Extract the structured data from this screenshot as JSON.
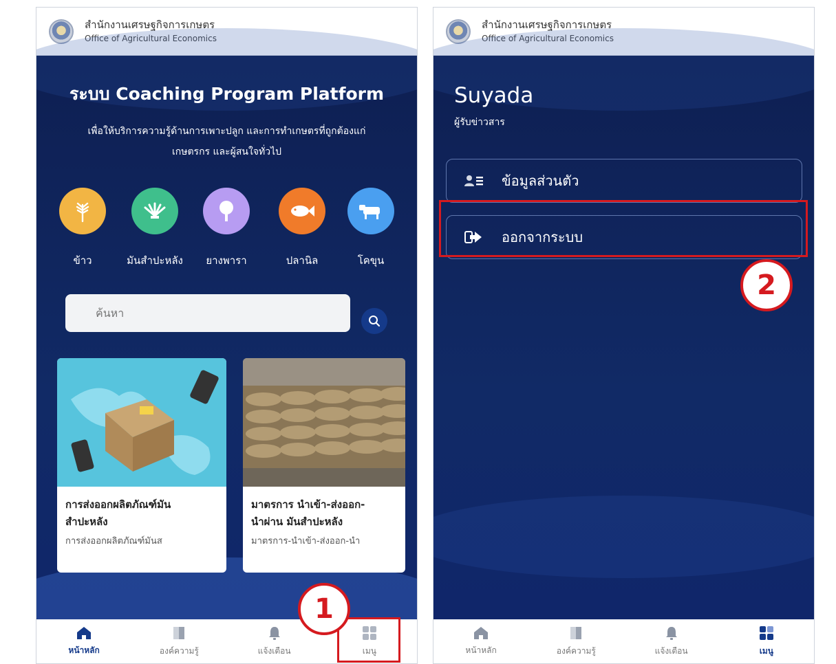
{
  "org": {
    "name_th": "สำนักงานเศรษฐกิจการเกษตร",
    "name_en": "Office of Agricultural Economics"
  },
  "home": {
    "title": "ระบบ Coaching Program Platform",
    "subtitle_line1": "เพื่อให้บริการความรู้ด้านการเพาะปลูก และการทำเกษตรที่ถูกต้องแก่",
    "subtitle_line2": "เกษตรกร และผู้สนใจทั่วไป",
    "categories": [
      {
        "label": "ข้าว",
        "icon": "rice-icon",
        "color": "#f2b544"
      },
      {
        "label": "มันสำปะหลัง",
        "icon": "cassava-icon",
        "color": "#3fbf8c"
      },
      {
        "label": "ยางพารา",
        "icon": "rubber-tree-icon",
        "color": "#b79cf2"
      },
      {
        "label": "ปลานิล",
        "icon": "fish-icon",
        "color": "#f07b2a"
      },
      {
        "label": "โคขุน",
        "icon": "cow-icon",
        "color": "#4a9ff0"
      }
    ],
    "search": {
      "placeholder": "ค้นหา"
    },
    "cards": [
      {
        "title_line1": "การส่งออกผลิตภัณฑ์มัน",
        "title_line2": "สำปะหลัง",
        "snippet": "การส่งออกผลิตภัณฑ์มันส"
      },
      {
        "title_line1": "มาตรการ นำเข้า-ส่งออก-",
        "title_line2": "นำผ่าน มันสำปะหลัง",
        "snippet": "มาตรการ-นำเข้า-ส่งออก-นำ"
      }
    ]
  },
  "menu_page": {
    "user_name": "Suyada",
    "user_role": "ผู้รับข่าวสาร",
    "items": [
      {
        "label": "ข้อมูลส่วนตัว",
        "icon": "user-list-icon"
      },
      {
        "label": "ออกจากระบบ",
        "icon": "logout-icon"
      }
    ]
  },
  "nav": [
    {
      "label": "หน้าหลัก",
      "icon": "home-icon"
    },
    {
      "label": "องค์ความรู้",
      "icon": "book-icon"
    },
    {
      "label": "แจ้งเตือน",
      "icon": "bell-icon"
    },
    {
      "label": "เมนู",
      "icon": "grid-menu-icon"
    }
  ],
  "annotations": {
    "step1": "1",
    "step2": "2",
    "highlight_color": "#d51a1f"
  }
}
